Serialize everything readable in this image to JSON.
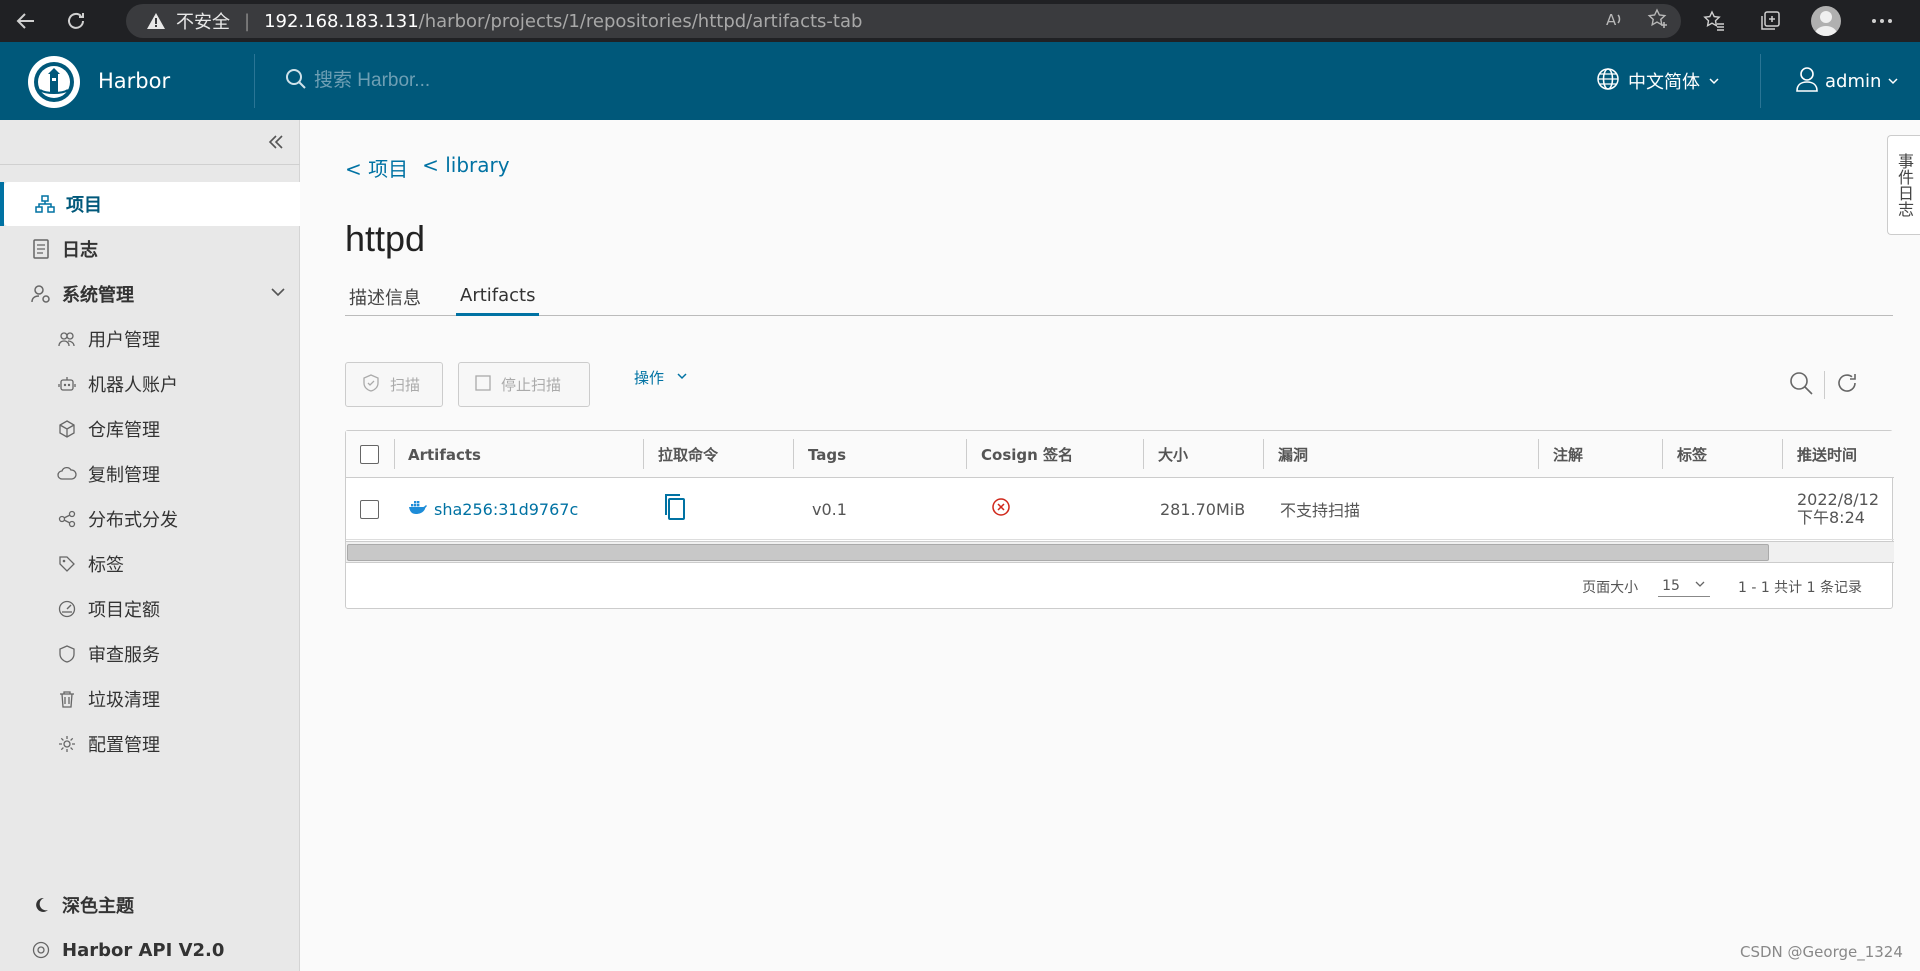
{
  "browser": {
    "insecure_label": "不安全",
    "url_host": "192.168.183.131",
    "url_path": "/harbor/projects/1/repositories/httpd/artifacts-tab"
  },
  "header": {
    "brand": "Harbor",
    "search_placeholder": "搜索 Harbor...",
    "language": "中文简体",
    "user": "admin"
  },
  "sidebar": {
    "items": [
      {
        "label": "项目",
        "icon": "project-icon"
      },
      {
        "label": "日志",
        "icon": "log-icon"
      },
      {
        "label": "系统管理",
        "icon": "admin-icon"
      },
      {
        "label": "用户管理",
        "icon": "users-icon"
      },
      {
        "label": "机器人账户",
        "icon": "robot-icon"
      },
      {
        "label": "仓库管理",
        "icon": "cube-icon"
      },
      {
        "label": "复制管理",
        "icon": "cloud-icon"
      },
      {
        "label": "分布式分发",
        "icon": "share-icon"
      },
      {
        "label": "标签",
        "icon": "tag-icon"
      },
      {
        "label": "项目定额",
        "icon": "dashboard-icon"
      },
      {
        "label": "审查服务",
        "icon": "shield-icon"
      },
      {
        "label": "垃圾清理",
        "icon": "trash-icon"
      },
      {
        "label": "配置管理",
        "icon": "gear-icon"
      }
    ],
    "dark_theme": "深色主题",
    "api_version": "Harbor API V2.0"
  },
  "main": {
    "breadcrumb": [
      "< 项目",
      "< library"
    ],
    "title": "httpd",
    "tabs": [
      "描述信息",
      "Artifacts"
    ],
    "toolbar": {
      "scan": "扫描",
      "stop_scan": "停止扫描",
      "actions": "操作"
    },
    "table": {
      "headers": [
        "Artifacts",
        "拉取命令",
        "Tags",
        "Cosign 签名",
        "大小",
        "漏洞",
        "注解",
        "标签",
        "推送时间"
      ],
      "rows": [
        {
          "artifact": "sha256:31d9767c",
          "tags": "v0.1",
          "size": "281.70MiB",
          "vulnerability": "不支持扫描",
          "push_date": "2022/8/12",
          "push_time": "下午8:24"
        }
      ]
    },
    "footer": {
      "page_size_label": "页面大小",
      "page_size": "15",
      "page_info": "1 - 1 共计 1 条记录"
    }
  },
  "event_log": "事件日志",
  "watermark": "CSDN @George_1324"
}
